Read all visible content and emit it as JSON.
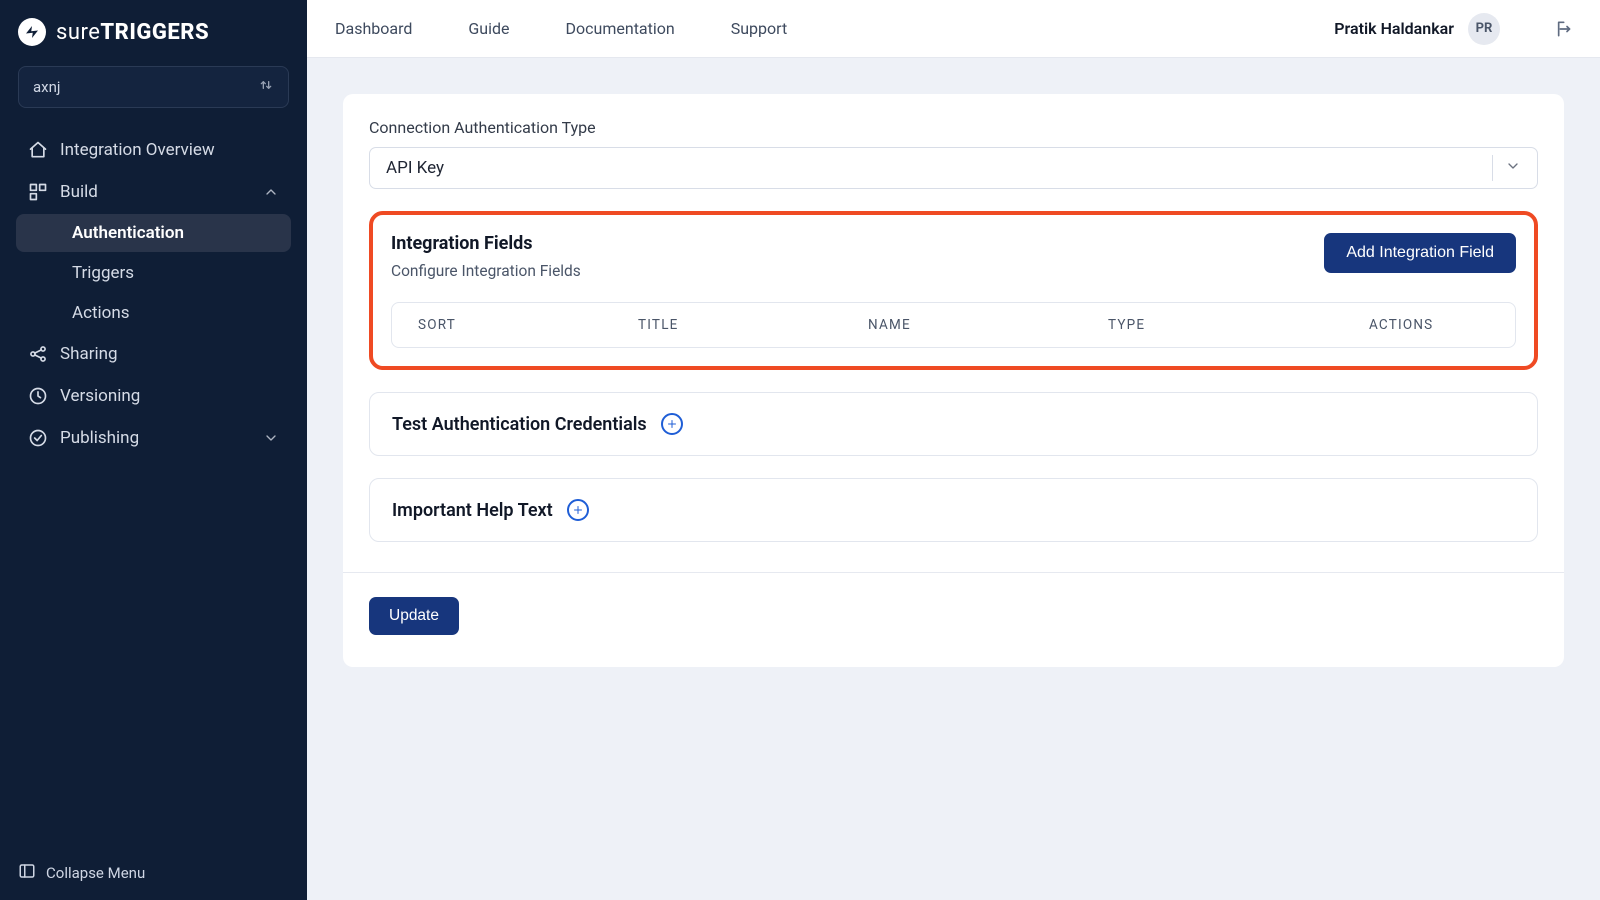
{
  "brand": {
    "name_light": "sure",
    "name_bold": "TRIGGERS"
  },
  "project_selector": {
    "value": "axnj"
  },
  "sidebar": {
    "overview": "Integration Overview",
    "build": {
      "label": "Build",
      "auth": "Authentication",
      "triggers": "Triggers",
      "actions": "Actions"
    },
    "sharing": "Sharing",
    "versioning": "Versioning",
    "publishing": "Publishing",
    "collapse": "Collapse Menu"
  },
  "topnav": {
    "dashboard": "Dashboard",
    "guide": "Guide",
    "docs": "Documentation",
    "support": "Support"
  },
  "user": {
    "name": "Pratik Haldankar",
    "initials": "PR"
  },
  "main": {
    "auth_type_label": "Connection Authentication Type",
    "auth_type_value": "API Key",
    "integration_fields": {
      "title": "Integration Fields",
      "subtitle": "Configure Integration Fields",
      "add_button": "Add Integration Field",
      "columns": {
        "sort": "SORT",
        "title": "TITLE",
        "name": "NAME",
        "type": "TYPE",
        "actions": "ACTIONS"
      }
    },
    "test_auth": "Test Authentication Credentials",
    "help_text": "Important Help Text",
    "update_button": "Update"
  }
}
